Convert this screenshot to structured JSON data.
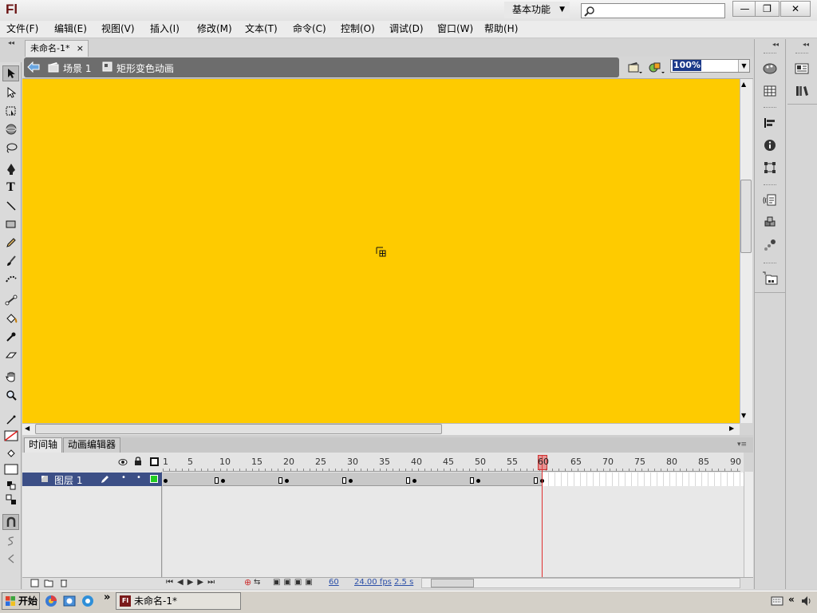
{
  "app": {
    "logo_text": "Fl",
    "workspace": "基本功能",
    "search_placeholder": ""
  },
  "window_controls": {
    "minimize": "—",
    "restore": "❐",
    "close": "✕"
  },
  "menu": {
    "items": [
      "文件(F)",
      "编辑(E)",
      "视图(V)",
      "插入(I)",
      "修改(M)",
      "文本(T)",
      "命令(C)",
      "控制(O)",
      "调试(D)",
      "窗口(W)",
      "帮助(H)"
    ]
  },
  "document": {
    "tab_title": "未命名-1*",
    "close_glyph": "×"
  },
  "editbar": {
    "scene": "场景 1",
    "symbol": "矩形变色动画",
    "zoom": "100%"
  },
  "stage": {
    "color": "#fecb00"
  },
  "timeline": {
    "tabs": [
      "时间轴",
      "动画编辑器"
    ],
    "frame_numbers": [
      "1",
      "5",
      "10",
      "15",
      "20",
      "25",
      "30",
      "35",
      "40",
      "45",
      "50",
      "55",
      "60",
      "65",
      "70",
      "75",
      "80",
      "85",
      "90"
    ],
    "layer_name": "图层 1",
    "current_frame": "60",
    "fps": "24.00 fps",
    "elapsed": "2.5 s"
  },
  "taskbar": {
    "start_label": "开始",
    "task_label": "未命名-1*",
    "more": "»"
  },
  "icons": {
    "tools": [
      "selection-icon",
      "subselection-icon",
      "free-transform-icon",
      "3d-rotation-icon",
      "lasso-icon",
      "pen-icon",
      "text-icon",
      "line-icon",
      "rectangle-icon",
      "pencil-icon",
      "brush-icon",
      "deco-icon",
      "bone-icon",
      "paint-bucket-icon",
      "eyedropper-icon",
      "eraser-icon",
      "hand-icon",
      "zoom-icon",
      "stroke-color-icon",
      "fill-color-icon",
      "swap-colors-icon",
      "snap-icon"
    ]
  }
}
